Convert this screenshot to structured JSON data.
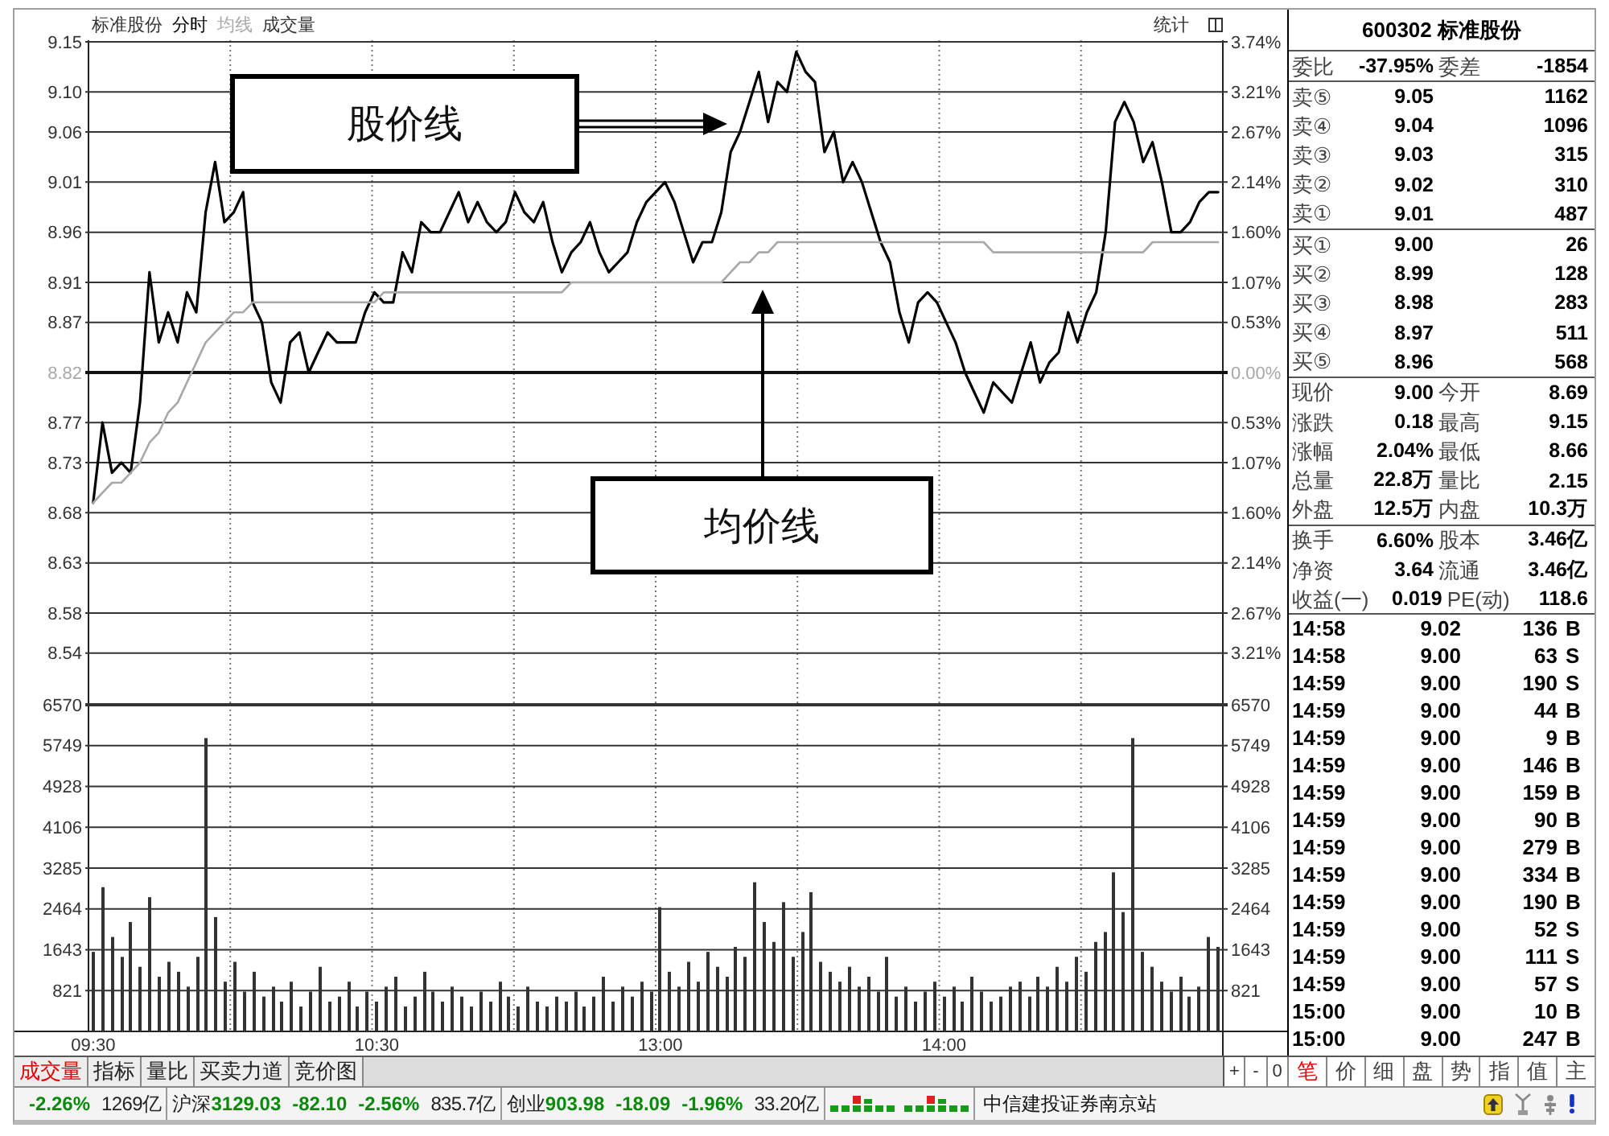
{
  "header": {
    "title": "标准股份",
    "volume_label": "成交量",
    "stats_button": "统计"
  },
  "price_chart": {
    "right_labels": [
      "3.74%",
      "3.21%",
      "2.67%",
      "2.14%",
      "1.60%",
      "1.07%",
      "0.53%",
      "0.00%",
      "0.53%",
      "1.07%",
      "1.60%",
      "2.14%",
      "2.67%",
      "3.21%"
    ],
    "chart_data": {
      "type": "line",
      "grid": true,
      "categories": [
        null,
        null,
        null,
        null,
        null,
        null,
        null,
        null,
        null,
        null,
        null,
        null,
        null,
        null,
        null,
        null,
        null,
        null,
        null,
        null,
        null,
        null,
        null,
        null,
        null,
        null,
        null,
        null,
        null,
        null,
        null,
        null,
        null,
        null,
        null,
        null,
        null,
        null,
        null,
        null,
        null,
        null,
        null,
        null,
        null,
        null,
        null,
        null,
        null,
        null,
        null,
        null,
        null,
        null,
        null,
        null,
        null,
        null,
        null,
        null,
        null,
        null,
        null,
        null,
        null,
        null,
        null,
        null,
        null,
        null,
        null,
        null,
        null,
        null,
        null,
        null,
        null,
        null,
        null,
        null,
        null,
        null,
        null,
        null,
        null,
        null,
        null,
        null,
        null,
        null,
        null,
        null,
        null,
        null,
        null,
        null,
        null,
        null,
        null,
        null,
        null,
        null,
        null,
        null,
        null,
        null,
        null,
        null,
        null,
        null,
        null,
        null,
        null,
        null,
        null,
        null,
        null,
        null,
        null,
        null,
        null
      ],
      "series": [
        {
          "name": "分时",
          "color": "#000000",
          "values": [
            8.69,
            8.77,
            8.72,
            8.73,
            8.72,
            8.79,
            8.92,
            8.85,
            8.88,
            8.85,
            8.9,
            8.88,
            8.98,
            9.03,
            8.97,
            8.98,
            9.0,
            8.89,
            8.87,
            8.81,
            8.79,
            8.85,
            8.86,
            8.82,
            8.84,
            8.86,
            8.85,
            8.85,
            8.85,
            8.88,
            8.9,
            8.89,
            8.89,
            8.94,
            8.92,
            8.97,
            8.96,
            8.96,
            8.98,
            9.0,
            8.97,
            8.99,
            8.97,
            8.96,
            8.97,
            9.0,
            8.98,
            8.97,
            8.99,
            8.95,
            8.92,
            8.94,
            8.95,
            8.97,
            8.94,
            8.92,
            8.93,
            8.94,
            8.97,
            8.99,
            9.0,
            9.01,
            8.99,
            8.96,
            8.93,
            8.95,
            8.95,
            8.98,
            9.04,
            9.06,
            9.09,
            9.12,
            9.07,
            9.11,
            9.1,
            9.14,
            9.12,
            9.11,
            9.04,
            9.06,
            9.01,
            9.03,
            9.01,
            8.98,
            8.95,
            8.93,
            8.88,
            8.85,
            8.89,
            8.9,
            8.89,
            8.87,
            8.85,
            8.82,
            8.8,
            8.78,
            8.81,
            8.8,
            8.79,
            8.82,
            8.85,
            8.81,
            8.83,
            8.84,
            8.88,
            8.85,
            8.88,
            8.9,
            8.96,
            9.07,
            9.09,
            9.07,
            9.03,
            9.05,
            9.01,
            8.96,
            8.96,
            8.97,
            8.99,
            9.0,
            9.0
          ]
        },
        {
          "name": "均线",
          "color": "#a8a8a8",
          "values": [
            8.69,
            8.7,
            8.71,
            8.71,
            8.72,
            8.73,
            8.75,
            8.76,
            8.78,
            8.79,
            8.81,
            8.83,
            8.85,
            8.86,
            8.87,
            8.88,
            8.88,
            8.89,
            8.89,
            8.89,
            8.89,
            8.89,
            8.89,
            8.89,
            8.89,
            8.89,
            8.89,
            8.89,
            8.89,
            8.89,
            8.89,
            8.9,
            8.9,
            8.9,
            8.9,
            8.9,
            8.9,
            8.9,
            8.9,
            8.9,
            8.9,
            8.9,
            8.9,
            8.9,
            8.9,
            8.9,
            8.9,
            8.9,
            8.9,
            8.9,
            8.9,
            8.91,
            8.91,
            8.91,
            8.91,
            8.91,
            8.91,
            8.91,
            8.91,
            8.91,
            8.91,
            8.91,
            8.91,
            8.91,
            8.91,
            8.91,
            8.91,
            8.91,
            8.92,
            8.93,
            8.93,
            8.94,
            8.94,
            8.95,
            8.95,
            8.95,
            8.95,
            8.95,
            8.95,
            8.95,
            8.95,
            8.95,
            8.95,
            8.95,
            8.95,
            8.95,
            8.95,
            8.95,
            8.95,
            8.95,
            8.95,
            8.95,
            8.95,
            8.95,
            8.95,
            8.95,
            8.94,
            8.94,
            8.94,
            8.94,
            8.94,
            8.94,
            8.94,
            8.94,
            8.94,
            8.94,
            8.94,
            8.94,
            8.94,
            8.94,
            8.94,
            8.94,
            8.94,
            8.95,
            8.95,
            8.95,
            8.95,
            8.95,
            8.95,
            8.95,
            8.95
          ]
        }
      ],
      "ylim": [
        8.49,
        9.15
      ],
      "yticks": [
        {
          "value": 9.15,
          "label": "9.15"
        },
        {
          "value": 9.1,
          "label": "9.10"
        },
        {
          "value": 9.06,
          "label": "9.06"
        },
        {
          "value": 9.01,
          "label": "9.01"
        },
        {
          "value": 8.96,
          "label": "8.96"
        },
        {
          "value": 8.91,
          "label": "8.91"
        },
        {
          "value": 8.87,
          "label": "8.87"
        },
        {
          "value": 8.82,
          "label": "8.82"
        },
        {
          "value": 8.77,
          "label": "8.77"
        },
        {
          "value": 8.73,
          "label": "8.73"
        },
        {
          "value": 8.68,
          "label": "8.68"
        },
        {
          "value": 8.63,
          "label": "8.63"
        },
        {
          "value": 8.58,
          "label": "8.58"
        },
        {
          "value": 8.54,
          "label": "8.54"
        }
      ],
      "ref_lines": [
        {
          "axis": "y",
          "value": 8.82
        }
      ],
      "annotations": [
        {
          "text": "股价线"
        },
        {
          "text": "均价线"
        }
      ]
    }
  },
  "volume_chart": {
    "right_labels": [
      "6570",
      "5749",
      "4928",
      "4106",
      "3285",
      "2464",
      "1643",
      "821"
    ],
    "chart_data": {
      "type": "bar",
      "grid": true,
      "categories": [
        "09:30",
        null,
        null,
        null,
        null,
        null,
        null,
        null,
        null,
        null,
        null,
        null,
        null,
        null,
        null,
        null,
        null,
        null,
        null,
        null,
        null,
        null,
        null,
        null,
        null,
        null,
        null,
        null,
        null,
        null,
        "10:30",
        null,
        null,
        null,
        null,
        null,
        null,
        null,
        null,
        null,
        null,
        null,
        null,
        null,
        null,
        null,
        null,
        null,
        null,
        null,
        null,
        null,
        null,
        null,
        null,
        null,
        null,
        null,
        null,
        null,
        "13:00",
        null,
        null,
        null,
        null,
        null,
        null,
        null,
        null,
        null,
        null,
        null,
        null,
        null,
        null,
        null,
        null,
        null,
        null,
        null,
        null,
        null,
        null,
        null,
        null,
        null,
        null,
        null,
        null,
        null,
        "14:00",
        null,
        null,
        null,
        null,
        null,
        null,
        null,
        null,
        null,
        null,
        null,
        null,
        null,
        null,
        null,
        null,
        null,
        null,
        null,
        null,
        null,
        null,
        null,
        null,
        null,
        null,
        null,
        null,
        null
      ],
      "values": [
        1600,
        2900,
        1900,
        1500,
        2200,
        1300,
        2700,
        1100,
        1400,
        1200,
        900,
        1500,
        5900,
        2300,
        1000,
        1400,
        800,
        1200,
        700,
        900,
        600,
        1000,
        500,
        800,
        1300,
        600,
        700,
        1000,
        500,
        800,
        600,
        900,
        1100,
        500,
        700,
        1200,
        800,
        600,
        900,
        700,
        500,
        800,
        600,
        1000,
        700,
        500,
        900,
        600,
        500,
        700,
        600,
        800,
        500,
        700,
        1100,
        600,
        900,
        700,
        1000,
        800,
        2500,
        1200,
        900,
        1400,
        1000,
        1600,
        1300,
        1100,
        1700,
        1500,
        3000,
        2200,
        1800,
        2600,
        1500,
        2000,
        2800,
        1400,
        1200,
        1000,
        1300,
        900,
        1100,
        800,
        1500,
        700,
        900,
        600,
        800,
        1000,
        700,
        900,
        600,
        1100,
        800,
        600,
        700,
        900,
        1000,
        700,
        1100,
        900,
        1300,
        1000,
        1500,
        1200,
        1800,
        2000,
        3200,
        2400,
        5900,
        1600,
        1300,
        1000,
        800,
        1100,
        700,
        900,
        1900,
        1700
      ],
      "ylim": [
        0,
        6570
      ],
      "yticks": [
        6570,
        5749,
        4928,
        4106,
        3285,
        2464,
        1643,
        821
      ]
    }
  },
  "quote_panel": {
    "title": "600302 标准股份",
    "order_imbalance": {
      "label": "委比",
      "value": "-37.95%",
      "label_2": "委差",
      "value_2": "-1854"
    },
    "asks": [
      {
        "label": "卖⑤",
        "price": "9.05",
        "volume": "1162"
      },
      {
        "label": "卖④",
        "price": "9.04",
        "volume": "1096"
      },
      {
        "label": "卖③",
        "price": "9.03",
        "volume": "315"
      },
      {
        "label": "卖②",
        "price": "9.02",
        "volume": "310"
      },
      {
        "label": "卖①",
        "price": "9.01",
        "volume": "487"
      }
    ],
    "bids": [
      {
        "label": "买①",
        "price": "9.00",
        "volume": "26"
      },
      {
        "label": "买②",
        "price": "8.99",
        "volume": "128"
      },
      {
        "label": "买③",
        "price": "8.98",
        "volume": "283"
      },
      {
        "label": "买④",
        "price": "8.97",
        "volume": "511"
      },
      {
        "label": "买⑤",
        "price": "8.96",
        "volume": "568"
      }
    ],
    "quote_stats": [
      {
        "label": "现价",
        "value": "9.00",
        "label_2": "今开",
        "value_2": "8.69"
      },
      {
        "label": "涨跌",
        "value": "0.18",
        "label_2": "最高",
        "value_2": "9.15"
      },
      {
        "label": "涨幅",
        "value": "2.04%",
        "label_2": "最低",
        "value_2": "8.66"
      },
      {
        "label": "总量",
        "value": "22.8万",
        "label_2": "量比",
        "value_2": "2.15"
      },
      {
        "label": "外盘",
        "value": "12.5万",
        "label_2": "内盘",
        "value_2": "10.3万"
      }
    ],
    "fundamentals": [
      {
        "label": "换手",
        "value": "6.60%",
        "label_2": "股本",
        "value_2": "3.46亿"
      },
      {
        "label": "净资",
        "value": "3.64",
        "label_2": "流通",
        "value_2": "3.46亿"
      },
      {
        "label": "收益(一)",
        "value": "0.019",
        "label_2": "PE(动)",
        "value_2": "118.6"
      }
    ],
    "trades": [
      {
        "time": "14:58",
        "price": "9.02",
        "volume": "136",
        "side": "B"
      },
      {
        "time": "14:58",
        "price": "9.00",
        "volume": "63",
        "side": "S"
      },
      {
        "time": "14:59",
        "price": "9.00",
        "volume": "190",
        "side": "S"
      },
      {
        "time": "14:59",
        "price": "9.00",
        "volume": "44",
        "side": "B"
      },
      {
        "time": "14:59",
        "price": "9.00",
        "volume": "9",
        "side": "B"
      },
      {
        "time": "14:59",
        "price": "9.00",
        "volume": "146",
        "side": "B"
      },
      {
        "time": "14:59",
        "price": "9.00",
        "volume": "159",
        "side": "B"
      },
      {
        "time": "14:59",
        "price": "9.00",
        "volume": "90",
        "side": "B"
      },
      {
        "time": "14:59",
        "price": "9.00",
        "volume": "279",
        "side": "B"
      },
      {
        "time": "14:59",
        "price": "9.00",
        "volume": "334",
        "side": "B"
      },
      {
        "time": "14:59",
        "price": "9.00",
        "volume": "190",
        "side": "B"
      },
      {
        "time": "14:59",
        "price": "9.00",
        "volume": "52",
        "side": "S"
      },
      {
        "time": "14:59",
        "price": "9.00",
        "volume": "111",
        "side": "S"
      },
      {
        "time": "14:59",
        "price": "9.00",
        "volume": "57",
        "side": "S"
      },
      {
        "time": "15:00",
        "price": "9.00",
        "volume": "10",
        "side": "B"
      },
      {
        "time": "15:00",
        "price": "9.00",
        "volume": "247",
        "side": "B"
      }
    ]
  },
  "bottom_tabs": {
    "chart_tabs": [
      {
        "label": "成交量",
        "selected": true
      },
      {
        "label": "指标",
        "selected": false
      },
      {
        "label": "量比",
        "selected": false
      },
      {
        "label": "买卖力道",
        "selected": false
      },
      {
        "label": "竞价图",
        "selected": false
      }
    ],
    "zoom_buttons": [
      "+",
      "-",
      "0"
    ],
    "panel_tabs": [
      {
        "label": "笔",
        "selected": true
      },
      {
        "label": "价",
        "selected": false
      },
      {
        "label": "细",
        "selected": false
      },
      {
        "label": "盘",
        "selected": false
      },
      {
        "label": "势",
        "selected": false
      },
      {
        "label": "指",
        "selected": false
      },
      {
        "label": "值",
        "selected": false
      },
      {
        "label": "主",
        "selected": false
      }
    ]
  },
  "status_bar": {
    "markets": [
      {
        "change_pct": "-2.26%",
        "amount": "1269亿"
      },
      {
        "name": "沪深",
        "index": "3129.03",
        "change": "-82.10",
        "change_pct": "-2.56%",
        "amount": "835.7亿"
      },
      {
        "name": "创业",
        "index": "903.98",
        "change": "-18.09",
        "change_pct": "-1.96%",
        "amount": "33.20亿"
      }
    ],
    "broker": "中信建投证券南京站"
  }
}
